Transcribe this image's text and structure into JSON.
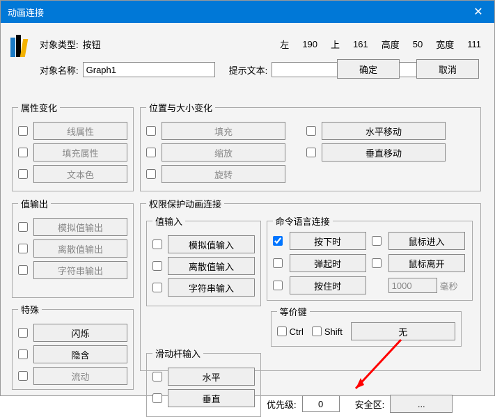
{
  "title": "动画连接",
  "top": {
    "obj_type_label": "对象类型:",
    "obj_type_value": "按钮",
    "left_lbl": "左",
    "left_val": "190",
    "top_lbl": "上",
    "top_val": "161",
    "height_lbl": "高度",
    "height_val": "50",
    "width_lbl": "宽度",
    "width_val": "111",
    "obj_name_label": "对象名称:",
    "obj_name_value": "Graph1",
    "hint_label": "提示文本:",
    "hint_value": ""
  },
  "fs": {
    "attr": {
      "legend": "属性变化",
      "b1": "线属性",
      "b2": "填充属性",
      "b3": "文本色"
    },
    "pos": {
      "legend": "位置与大小变化",
      "b1": "填充",
      "b2": "缩放",
      "b3": "旋转",
      "b4": "水平移动",
      "b5": "垂直移动"
    },
    "valout": {
      "legend": "值输出",
      "b1": "模拟值输出",
      "b2": "离散值输出",
      "b3": "字符串输出"
    },
    "perm": {
      "legend": "权限保护动画连接"
    },
    "valin": {
      "legend": "值输入",
      "b1": "模拟值输入",
      "b2": "离散值输入",
      "b3": "字符串输入"
    },
    "slide": {
      "legend": "滑动杆输入",
      "b1": "水平",
      "b2": "垂直"
    },
    "cmd": {
      "legend": "命令语言连接",
      "b1": "按下时",
      "b2": "鼠标进入",
      "b3": "弹起时",
      "b4": "鼠标离开",
      "b5": "按住时",
      "ms_val": "1000",
      "ms_lbl": "毫秒"
    },
    "equiv": {
      "legend": "等价键",
      "ctrl": "Ctrl",
      "shift": "Shift",
      "b1": "无"
    },
    "special": {
      "legend": "特殊",
      "b1": "闪烁",
      "b2": "隐含",
      "b3": "流动"
    },
    "prio_lbl": "优先级:",
    "prio_val": "0",
    "safe_lbl": "安全区:",
    "safe_btn": "..."
  },
  "buttons": {
    "ok": "确定",
    "cancel": "取消"
  }
}
